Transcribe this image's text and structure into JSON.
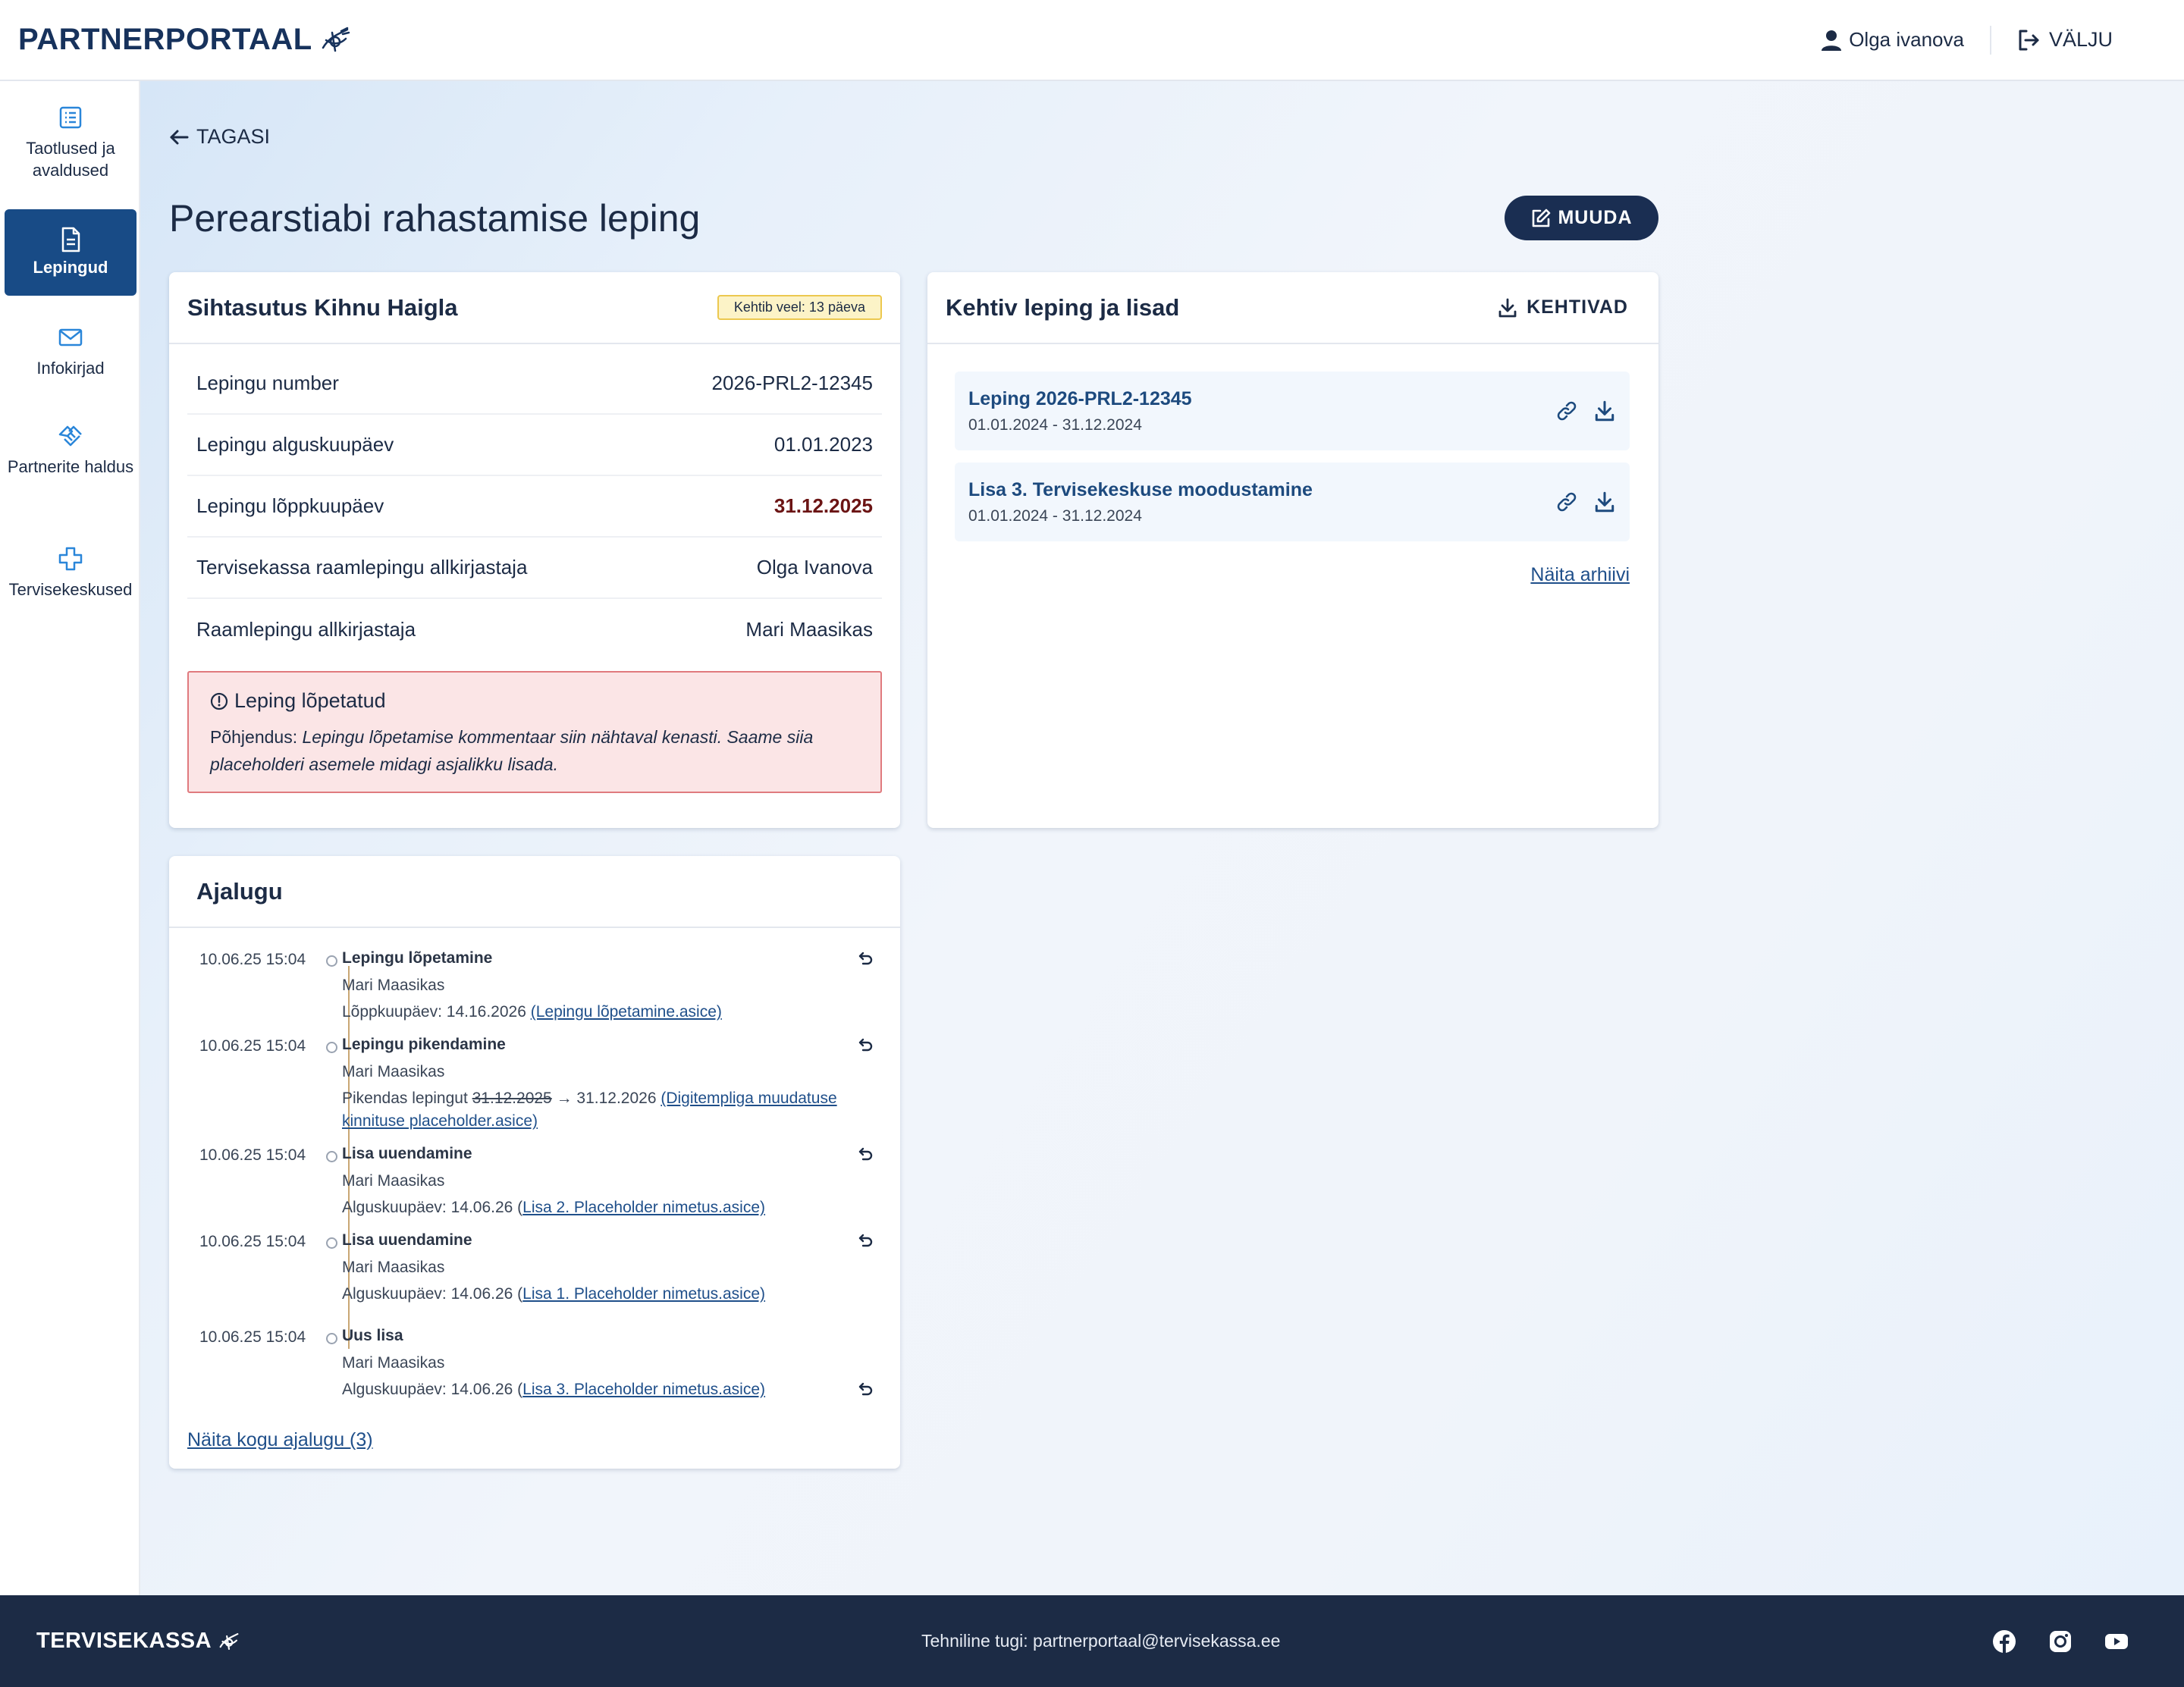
{
  "header": {
    "logo_text": "PARTNERPORTAAL",
    "user_name": "Olga ivanova",
    "logout_label": "VÄLJU"
  },
  "sidebar": {
    "items": [
      {
        "label": "Taotlused ja avaldused",
        "icon": "list-icon",
        "active": false
      },
      {
        "label": "Lepingud",
        "icon": "document-icon",
        "active": true
      },
      {
        "label": "Infokirjad",
        "icon": "mail-icon",
        "active": false
      },
      {
        "label": "Partnerite haldus",
        "icon": "handshake-icon",
        "active": false
      },
      {
        "label": "Tervisekeskused",
        "icon": "medical-cross-icon",
        "active": false
      }
    ]
  },
  "main": {
    "back_label": "TAGASI",
    "page_title": "Perearstiabi rahastamise leping",
    "edit_label": "MUUDA"
  },
  "info_card": {
    "title": "Sihtasutus Kihnu Haigla",
    "badge": "Kehtib veel: 13 päeva",
    "rows": [
      {
        "label": "Lepingu number",
        "value": "2026-PRL2-12345"
      },
      {
        "label": "Lepingu alguskuupäev",
        "value": "01.01.2023"
      },
      {
        "label": "Lepingu lõppkuupäev",
        "value": "31.12.2025"
      },
      {
        "label": "Tervisekassa raamlepingu allkirjastaja",
        "value": "Olga Ivanova"
      },
      {
        "label": "Raamlepingu allkirjastaja",
        "value": "Mari Maasikas"
      }
    ],
    "alert": {
      "title": "Leping lõpetatud",
      "reason_label": "Põhjendus:",
      "reason_text": "Lepingu lõpetamise kommentaar siin nähtaval kenasti. Saame siia placeholderi asemele midagi asjalikku lisada."
    }
  },
  "current_card": {
    "title": "Kehtiv leping ja lisad",
    "download_label": "KEHTIVAD",
    "documents": [
      {
        "name": "Leping 2026-PRL2-12345",
        "dates": "01.01.2024 - 31.12.2024"
      },
      {
        "name": "Lisa 3. Tervisekeskuse moodustamine",
        "dates": "01.01.2024 - 31.12.2024"
      }
    ],
    "archive_link": "Näita arhiivi"
  },
  "history_card": {
    "title": "Ajalugu",
    "entries": [
      {
        "time": "10.06.25 15:04",
        "title": "Lepingu lõpetamine",
        "user": "Mari Maasikas",
        "detail_prefix": "Lõppkuupäev: 14.16.2026 ",
        "link": "(Lepingu lõpetamine.asice)"
      },
      {
        "time": "10.06.25 15:04",
        "title": "Lepingu pikendamine",
        "user": "Mari Maasikas",
        "detail_prefix": "Pikendas lepingut ",
        "old_date": "31.12.2025",
        "detail_mid": " → 31.12.2026 ",
        "link": "(Digitempliga muudatuse kinnituse placeholder.asice)"
      },
      {
        "time": "10.06.25 15:04",
        "title": "Lisa uuendamine",
        "user": "Mari Maasikas",
        "detail_prefix": "Alguskuupäev: 14.06.26 (",
        "link": "Lisa 2. Placeholder nimetus.asice)"
      },
      {
        "time": "10.06.25 15:04",
        "title": "Lisa uuendamine",
        "user": "Mari Maasikas",
        "detail_prefix": "Alguskuupäev: 14.06.26 (",
        "link": "Lisa 1. Placeholder nimetus.asice)"
      },
      {
        "time": "10.06.25 15:04",
        "title": "Uus lisa",
        "user": "Mari Maasikas",
        "detail_prefix": "Alguskuupäev: 14.06.26 (",
        "link": "Lisa 3. Placeholder nimetus.asice)"
      }
    ],
    "show_all_link": "Näita kogu ajalugu (3)"
  },
  "footer": {
    "logo_text": "TERVISEKASSA",
    "support_text": "Tehniline tugi: partnerportaal@tervisekassa.ee",
    "social": [
      "facebook-icon",
      "instagram-icon",
      "youtube-icon"
    ]
  },
  "colors": {
    "primary_dark": "#1c2b45",
    "sidebar_active": "#184b86",
    "link": "#1f4f8a",
    "alert_bg": "#fbe5e6",
    "alert_border": "#e07a7e",
    "badge_bg": "#fcf3c7",
    "end_date": "#6b1414"
  }
}
